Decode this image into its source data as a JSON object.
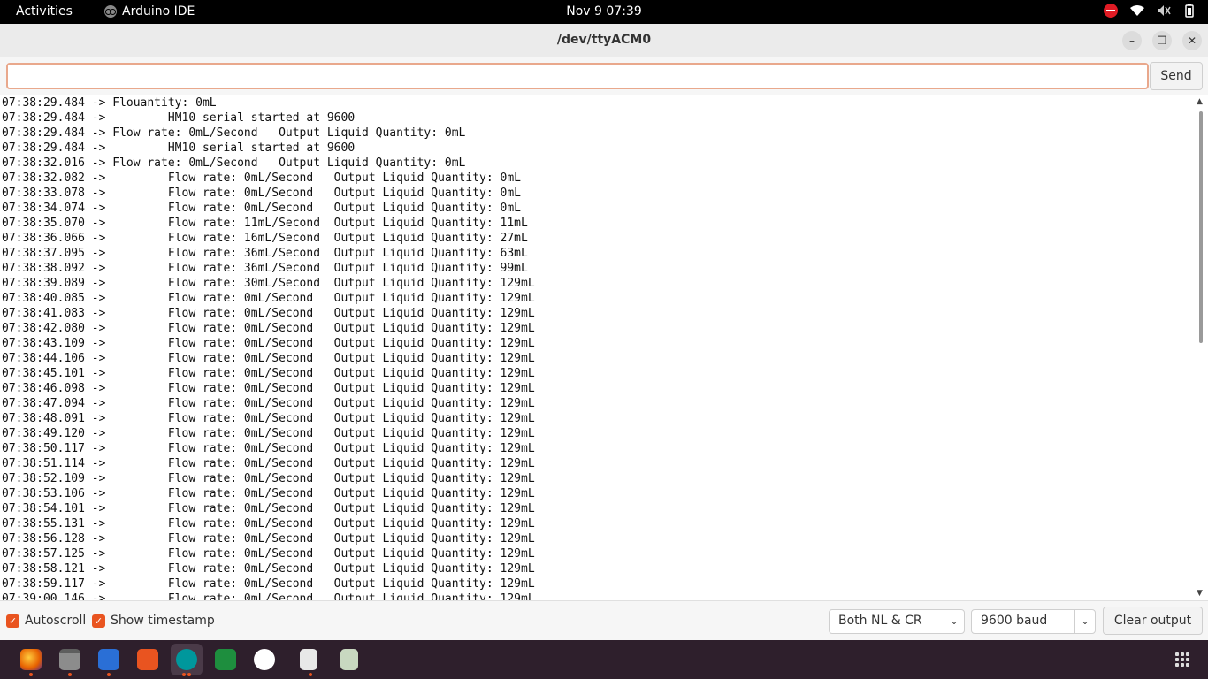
{
  "topbar": {
    "activities": "Activities",
    "app_name": "Arduino IDE",
    "clock": "Nov 9  07:39"
  },
  "window": {
    "title": "/dev/ttyACM0",
    "minimize": "–",
    "maximize": "❐",
    "close": "✕"
  },
  "input": {
    "value": "",
    "send_label": "Send"
  },
  "output_lines": [
    "07:38:29.484 -> Flouantity: 0mL",
    "07:38:29.484 ->         HM10 serial started at 9600",
    "07:38:29.484 -> Flow rate: 0mL/Second   Output Liquid Quantity: 0mL",
    "07:38:29.484 ->         HM10 serial started at 9600",
    "07:38:32.016 -> Flow rate: 0mL/Second   Output Liquid Quantity: 0mL",
    "07:38:32.082 ->         Flow rate: 0mL/Second   Output Liquid Quantity: 0mL",
    "07:38:33.078 ->         Flow rate: 0mL/Second   Output Liquid Quantity: 0mL",
    "07:38:34.074 ->         Flow rate: 0mL/Second   Output Liquid Quantity: 0mL",
    "07:38:35.070 ->         Flow rate: 11mL/Second  Output Liquid Quantity: 11mL",
    "07:38:36.066 ->         Flow rate: 16mL/Second  Output Liquid Quantity: 27mL",
    "07:38:37.095 ->         Flow rate: 36mL/Second  Output Liquid Quantity: 63mL",
    "07:38:38.092 ->         Flow rate: 36mL/Second  Output Liquid Quantity: 99mL",
    "07:38:39.089 ->         Flow rate: 30mL/Second  Output Liquid Quantity: 129mL",
    "07:38:40.085 ->         Flow rate: 0mL/Second   Output Liquid Quantity: 129mL",
    "07:38:41.083 ->         Flow rate: 0mL/Second   Output Liquid Quantity: 129mL",
    "07:38:42.080 ->         Flow rate: 0mL/Second   Output Liquid Quantity: 129mL",
    "07:38:43.109 ->         Flow rate: 0mL/Second   Output Liquid Quantity: 129mL",
    "07:38:44.106 ->         Flow rate: 0mL/Second   Output Liquid Quantity: 129mL",
    "07:38:45.101 ->         Flow rate: 0mL/Second   Output Liquid Quantity: 129mL",
    "07:38:46.098 ->         Flow rate: 0mL/Second   Output Liquid Quantity: 129mL",
    "07:38:47.094 ->         Flow rate: 0mL/Second   Output Liquid Quantity: 129mL",
    "07:38:48.091 ->         Flow rate: 0mL/Second   Output Liquid Quantity: 129mL",
    "07:38:49.120 ->         Flow rate: 0mL/Second   Output Liquid Quantity: 129mL",
    "07:38:50.117 ->         Flow rate: 0mL/Second   Output Liquid Quantity: 129mL",
    "07:38:51.114 ->         Flow rate: 0mL/Second   Output Liquid Quantity: 129mL",
    "07:38:52.109 ->         Flow rate: 0mL/Second   Output Liquid Quantity: 129mL",
    "07:38:53.106 ->         Flow rate: 0mL/Second   Output Liquid Quantity: 129mL",
    "07:38:54.101 ->         Flow rate: 0mL/Second   Output Liquid Quantity: 129mL",
    "07:38:55.131 ->         Flow rate: 0mL/Second   Output Liquid Quantity: 129mL",
    "07:38:56.128 ->         Flow rate: 0mL/Second   Output Liquid Quantity: 129mL",
    "07:38:57.125 ->         Flow rate: 0mL/Second   Output Liquid Quantity: 129mL",
    "07:38:58.121 ->         Flow rate: 0mL/Second   Output Liquid Quantity: 129mL",
    "07:38:59.117 ->         Flow rate: 0mL/Second   Output Liquid Quantity: 129mL",
    "07:39:00.146 ->         Flow rate: 0mL/Second   Output Liquid Quantity: 129mL"
  ],
  "bottom": {
    "autoscroll_label": "Autoscroll",
    "timestamp_label": "Show timestamp",
    "line_ending": "Both NL & CR",
    "baud": "9600 baud",
    "clear_label": "Clear output"
  },
  "taskbar_icons": [
    "firefox-icon",
    "files-icon",
    "writer-icon",
    "app-center-icon",
    "arduino-icon",
    "calc-icon",
    "writer-w-icon",
    "text-editor-icon",
    "trash-icon"
  ],
  "colors": {
    "accent": "#e95420",
    "taskbar": "#2e1f2c",
    "dnd": "#e01b24"
  }
}
